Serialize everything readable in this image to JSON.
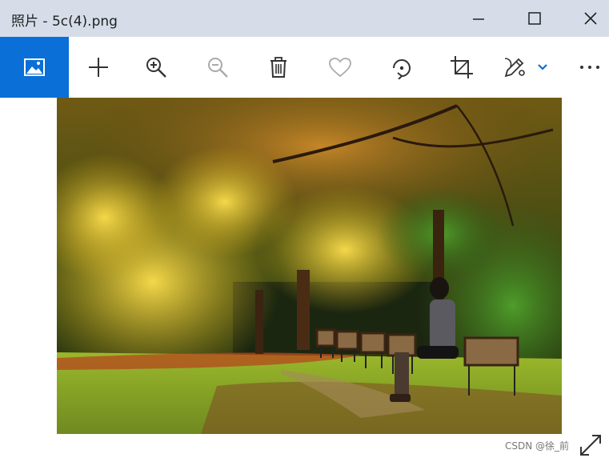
{
  "window": {
    "title": "照片 - 5c(4).png"
  },
  "toolbar": {
    "items": [
      {
        "name": "photo-icon"
      },
      {
        "name": "add-icon"
      },
      {
        "name": "zoom-in-icon"
      },
      {
        "name": "zoom-out-icon"
      },
      {
        "name": "delete-icon"
      },
      {
        "name": "favorite-icon"
      },
      {
        "name": "rotate-icon"
      },
      {
        "name": "crop-icon"
      },
      {
        "name": "edit-icon"
      },
      {
        "name": "more-icon"
      }
    ],
    "accent_color": "#0a6fd6"
  },
  "image": {
    "description_hidden": ""
  },
  "watermark": {
    "text": "CSDN @徐_前"
  }
}
